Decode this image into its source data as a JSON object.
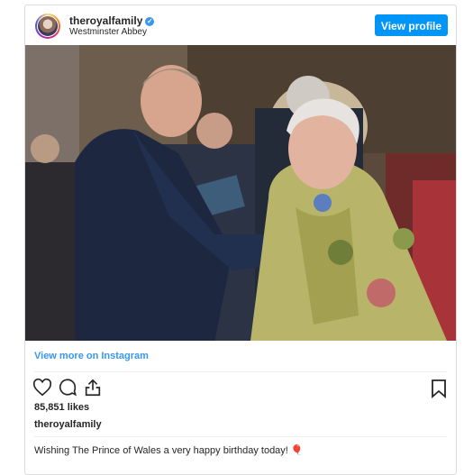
{
  "post": {
    "username": "theroyalfamily",
    "location": "Westminster Abbey",
    "view_profile_label": "View profile",
    "view_more_label": "View more on Instagram",
    "likes": "85,851 likes",
    "caption_username": "theroyalfamily",
    "caption_text": "Wishing The Prince of Wales a very happy birthday today!",
    "caption_emoji": "🎈"
  },
  "icons": {
    "verified": "verified-badge",
    "like": "heart-outline",
    "comment": "speech-bubble",
    "share": "share-upload",
    "save": "bookmark-outline"
  },
  "colors": {
    "accent": "#0095f6",
    "link": "#3897f0",
    "text": "#262626"
  }
}
